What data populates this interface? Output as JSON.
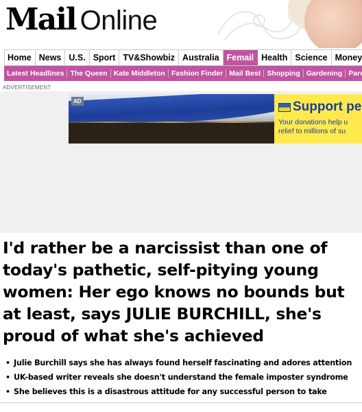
{
  "masthead": {
    "logo_mail": "Mail",
    "logo_online": "Online"
  },
  "nav_primary": [
    {
      "label": "Home",
      "active": false
    },
    {
      "label": "News",
      "active": false
    },
    {
      "label": "U.S.",
      "active": false
    },
    {
      "label": "Sport",
      "active": false
    },
    {
      "label": "TV&Showbiz",
      "active": false
    },
    {
      "label": "Australia",
      "active": false
    },
    {
      "label": "Femail",
      "active": true
    },
    {
      "label": "Health",
      "active": false
    },
    {
      "label": "Science",
      "active": false
    },
    {
      "label": "Money",
      "active": false
    }
  ],
  "nav_secondary": [
    "Latest Headlines",
    "The Queen",
    "Kate Middleton",
    "Fashion Finder",
    "Mail Best",
    "Shopping",
    "Gardening",
    "Parenting"
  ],
  "advert": {
    "label": "ADVERTISEMENT",
    "badge": "AD",
    "headline": "Support pe",
    "body_line1": "Your donations help u",
    "body_line2": "relief to millions of su"
  },
  "article": {
    "headline": "I'd rather be a narcissist than one of today's pathetic, self-pitying young women: Her ego knows no bounds but at least, says JULIE BURCHILL, she's proud of what she's achieved",
    "bullets": [
      "Julie Burchill says she has always found herself fascinating and adores attention",
      "UK-based writer reveals she doesn't understand the female imposter syndrome",
      "She believes this is a disastrous attitude for any successful person to take"
    ]
  },
  "colors": {
    "femail_accent": "#c154a0",
    "ad_yellow": "#ffe94d",
    "ad_blue": "#1a3f9e"
  }
}
